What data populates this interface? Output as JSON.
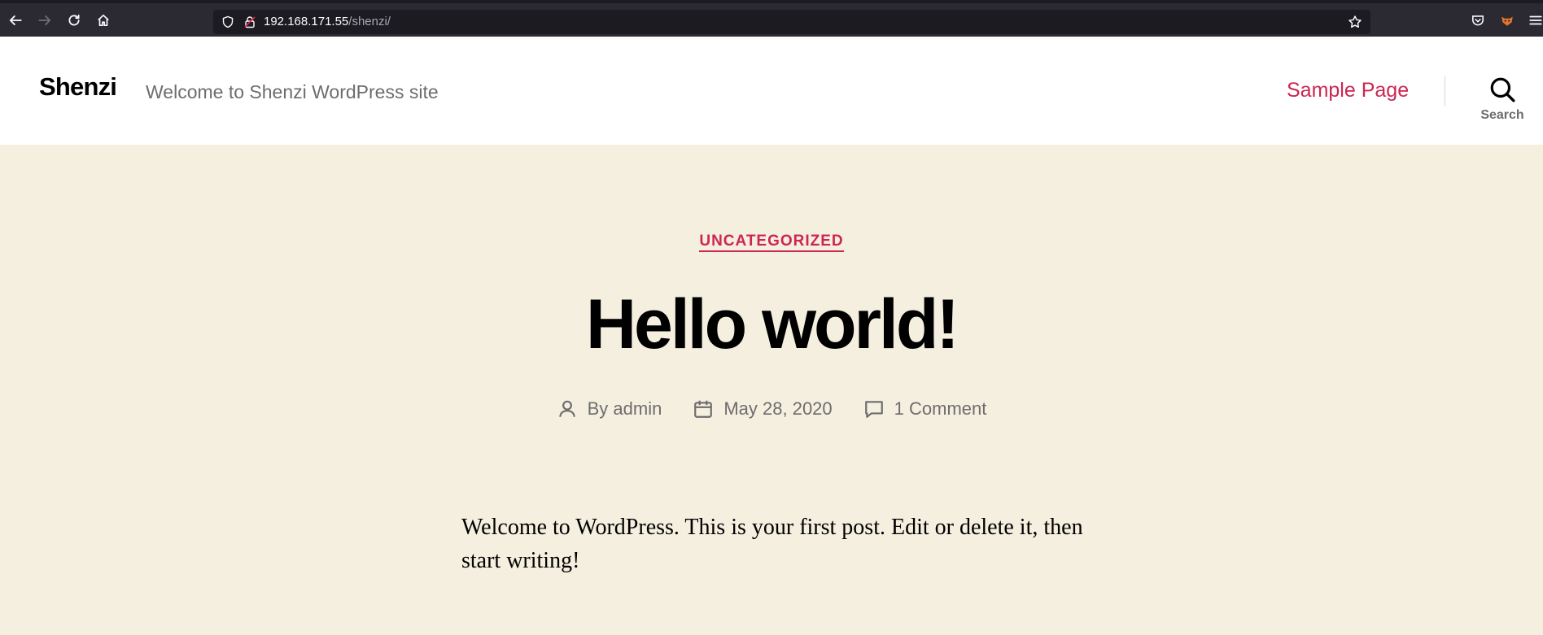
{
  "browser": {
    "url_host": "192.168.171.55",
    "url_path": "/shenzi/"
  },
  "header": {
    "site_title": "Shenzi",
    "site_description": "Welcome to Shenzi WordPress site",
    "nav_sample_page": "Sample Page",
    "search_label": "Search"
  },
  "post": {
    "category": "UNCATEGORIZED",
    "title": "Hello world!",
    "author_prefix": "By ",
    "author": "admin",
    "date": "May 28, 2020",
    "comments": "1 Comment",
    "content": "Welcome to WordPress. This is your first post. Edit or delete it, then start writing!"
  },
  "colors": {
    "accent": "#cd2653",
    "background": "#f5efe0",
    "header_bg": "#ffffff",
    "toolbar_bg": "#2b2a33"
  }
}
